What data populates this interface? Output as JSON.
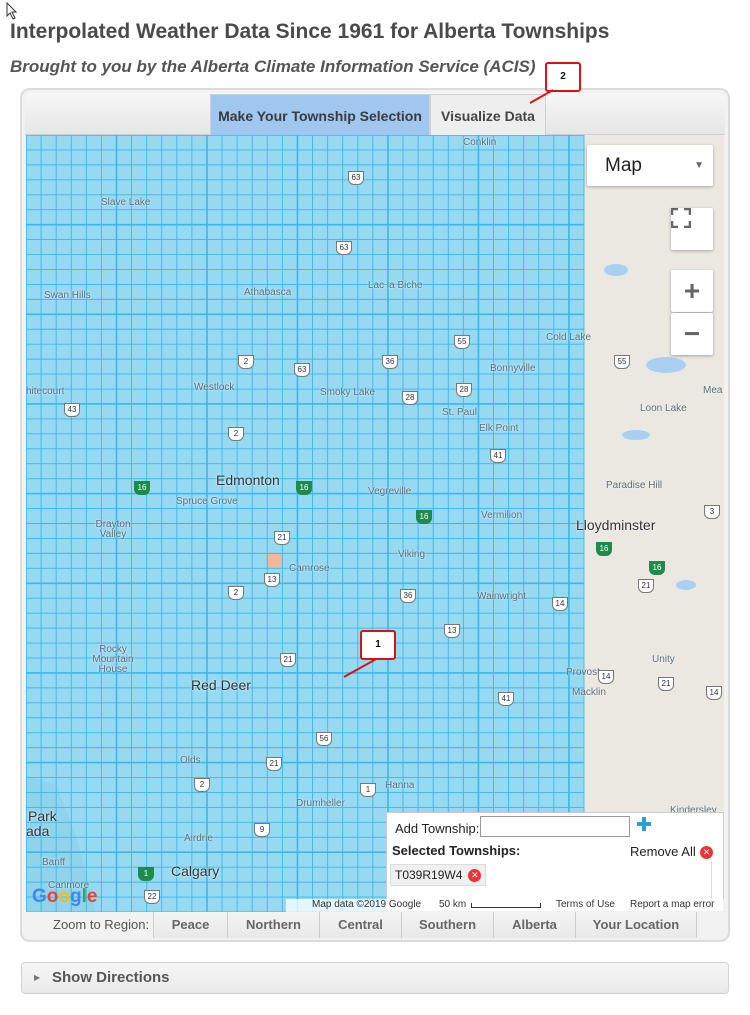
{
  "header": {
    "title": "Interpolated Weather Data Since 1961 for Alberta Townships",
    "subtitle": "Brought to you by the Alberta Climate Information Service (ACIS)"
  },
  "tabs": [
    {
      "label": "Make Your Township Selection",
      "active": true
    },
    {
      "label": "Visualize Data",
      "active": false
    }
  ],
  "map": {
    "type_select": "Map",
    "places": [
      {
        "id": "conklin",
        "label": "Conklin"
      },
      {
        "id": "slave-lake",
        "label": "Slave Lake"
      },
      {
        "id": "swan-hills",
        "label": "Swan Hills"
      },
      {
        "id": "athabasca",
        "label": "Athabasca"
      },
      {
        "id": "lac-la-biche",
        "label": "Lac la Biche"
      },
      {
        "id": "cold-lake",
        "label": "Cold Lake"
      },
      {
        "id": "whitecourt",
        "label": "hitecourt"
      },
      {
        "id": "westlock",
        "label": "Westlock"
      },
      {
        "id": "smoky-lake",
        "label": "Smoky Lake"
      },
      {
        "id": "bonnyville",
        "label": "Bonnyville"
      },
      {
        "id": "st-paul",
        "label": "St. Paul"
      },
      {
        "id": "elk-point",
        "label": "Elk Point"
      },
      {
        "id": "loon-lake",
        "label": "Loon Lake"
      },
      {
        "id": "mea",
        "label": "Mea"
      },
      {
        "id": "edmonton",
        "label": "Edmonton"
      },
      {
        "id": "spruce-grove",
        "label": "Spruce Grove"
      },
      {
        "id": "vegreville",
        "label": "Vegreville"
      },
      {
        "id": "vermilion",
        "label": "Vermilion"
      },
      {
        "id": "lloydminster",
        "label": "Lloydminster"
      },
      {
        "id": "paradise-hill",
        "label": "Paradise Hill"
      },
      {
        "id": "drayton-valley",
        "label": "Drayton Valley"
      },
      {
        "id": "viking",
        "label": "Viking"
      },
      {
        "id": "camrose",
        "label": "Camrose"
      },
      {
        "id": "wainwright",
        "label": "Wainwright"
      },
      {
        "id": "rocky-mountain-house",
        "label": "Rocky Mountain House"
      },
      {
        "id": "red-deer",
        "label": "Red Deer"
      },
      {
        "id": "provost",
        "label": "Provost"
      },
      {
        "id": "macklin",
        "label": "Macklin"
      },
      {
        "id": "unity",
        "label": "Unity"
      },
      {
        "id": "olds",
        "label": "Olds"
      },
      {
        "id": "hanna",
        "label": "Hanna"
      },
      {
        "id": "drumheller",
        "label": "Drumheller"
      },
      {
        "id": "airdrie",
        "label": "Airdrie"
      },
      {
        "id": "calgary",
        "label": "Calgary"
      },
      {
        "id": "canmore",
        "label": "Canmore"
      },
      {
        "id": "banff",
        "label": "Banff"
      },
      {
        "id": "park",
        "label": "Park"
      },
      {
        "id": "ada",
        "label": "ada"
      },
      {
        "id": "kindersley",
        "label": "Kindersley"
      }
    ],
    "shields": [
      "63",
      "63",
      "55",
      "2",
      "63",
      "36",
      "28",
      "28",
      "43",
      "2",
      "41",
      "16",
      "16",
      "16",
      "16",
      "21",
      "13",
      "36",
      "14",
      "2",
      "13",
      "21",
      "41",
      "56",
      "21",
      "2",
      "9",
      "1",
      "22",
      "1",
      "55",
      "3",
      "16",
      "21",
      "14",
      "21",
      "14",
      "41"
    ],
    "selected_cell": {
      "row": 28,
      "col": 16
    },
    "footer": {
      "map_data": "Map data ©2019 Google",
      "scale": "50 km",
      "terms": "Terms of Use",
      "report": "Report a map error"
    },
    "google_logo": "Google"
  },
  "selection": {
    "add_label": "Add Township:",
    "add_value": "",
    "selected_label": "Selected Townships:",
    "remove_all_label": "Remove All",
    "townships": [
      "T039R19W4"
    ]
  },
  "annotations": [
    {
      "label": "1"
    },
    {
      "label": "2"
    }
  ],
  "zoom": {
    "label": "Zoom to Region:",
    "regions": [
      "Peace",
      "Northern",
      "Central",
      "Southern",
      "Alberta",
      "Your Location"
    ]
  },
  "directions": {
    "label": "Show Directions"
  },
  "colors": {
    "grid_fill": "#8fd7f2",
    "grid_line": "#3ab7ee",
    "selected_cell": "#f2b79a",
    "active_tab": "#9fc7ef",
    "annotation_border": "#dd1111"
  }
}
